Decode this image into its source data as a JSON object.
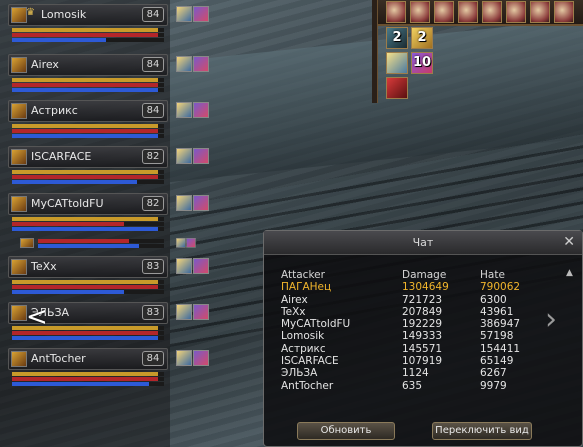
{
  "party": [
    {
      "name": "Lomosik",
      "leader_icon": "crown-icon",
      "level": "84",
      "cp": 0.96,
      "hp": 0.96,
      "mp": 0.62
    },
    {
      "name": "Airex",
      "level": "84",
      "cp": 0.96,
      "hp": 0.96,
      "mp": 0.96
    },
    {
      "name": "Астрикс",
      "level": "84",
      "cp": 0.96,
      "hp": 0.96,
      "mp": 0.96
    },
    {
      "name": "ISCARFACE",
      "level": "82",
      "cp": 0.96,
      "hp": 0.96,
      "mp": 0.82
    },
    {
      "name": "MyCATtoldFU",
      "level": "82",
      "cp": 0.96,
      "hp": 0.74,
      "mp": 0.96
    },
    {
      "name": "",
      "level": "",
      "cp": 0.0,
      "hp": 0.72,
      "mp": 0.8
    },
    {
      "name": "TeXx",
      "level": "83",
      "cp": 0.96,
      "hp": 0.96,
      "mp": 0.74
    },
    {
      "name": "ЭЛЬЗА",
      "level": "83",
      "cp": 0.96,
      "hp": 0.96,
      "mp": 0.96
    },
    {
      "name": "AntTocher",
      "level": "84",
      "cp": 0.96,
      "hp": 0.96,
      "mp": 0.9
    }
  ],
  "skills": [
    {
      "icon": "skill-a-icon",
      "count": "2"
    },
    {
      "icon": "skill-b-icon",
      "count": "2"
    },
    {
      "icon": "skill-c-icon",
      "count": ""
    },
    {
      "icon": "skill-d-icon",
      "count": "10"
    },
    {
      "icon": "skill-e-icon",
      "count": ""
    }
  ],
  "chat": {
    "title": "Чат",
    "close": "✕",
    "headers": [
      "Attacker",
      "Damage",
      "Hate"
    ],
    "rows": [
      {
        "attacker": "ПАГАНец",
        "damage": "1304649",
        "hate": "790062",
        "highlight": true
      },
      {
        "attacker": "Airex",
        "damage": "721723",
        "hate": "6300"
      },
      {
        "attacker": "TeXx",
        "damage": "207849",
        "hate": "43961"
      },
      {
        "attacker": "MyCATtoldFU",
        "damage": "192229",
        "hate": "386947"
      },
      {
        "attacker": "Lomosik",
        "damage": "149333",
        "hate": "57198"
      },
      {
        "attacker": "Астрикс",
        "damage": "145571",
        "hate": "154411"
      },
      {
        "attacker": "ISCARFACE",
        "damage": "107919",
        "hate": "65149"
      },
      {
        "attacker": "ЭЛЬЗА",
        "damage": "1124",
        "hate": "6267"
      },
      {
        "attacker": "AntTocher",
        "damage": "635",
        "hate": "9979"
      }
    ],
    "refresh_label": "Обновить",
    "switch_label": "Переключить вид"
  },
  "colors": {
    "cp": "#c89a2a",
    "hp": "#b3262a",
    "mp": "#2d5ad6",
    "highlight": "#f1b52c"
  }
}
